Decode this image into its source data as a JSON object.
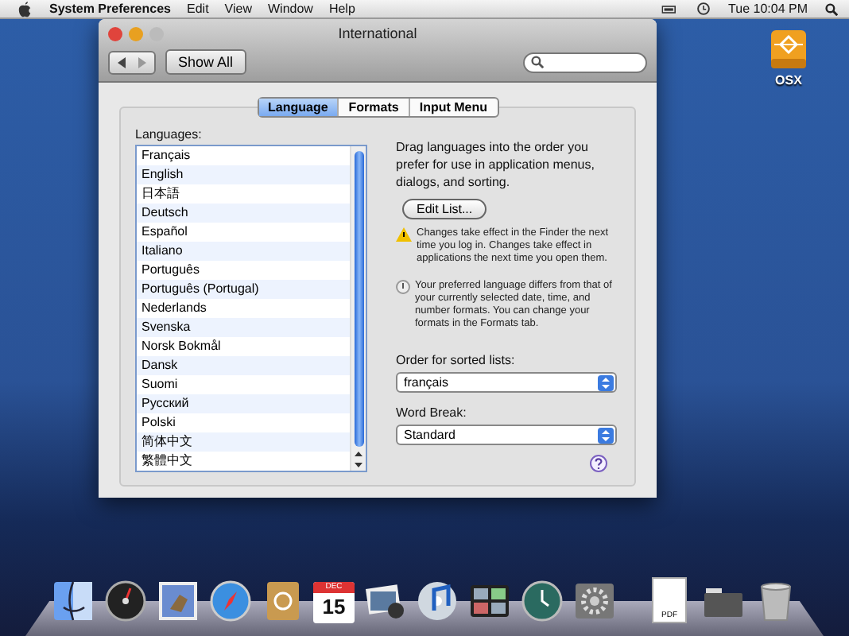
{
  "menu_bar": {
    "app": "System Preferences",
    "items": [
      "Edit",
      "View",
      "Window",
      "Help"
    ],
    "clock": "Tue 10:04 PM"
  },
  "desktop_icons": [
    {
      "label": "OSX"
    }
  ],
  "window": {
    "title": "International",
    "show_all": "Show All",
    "tabs": [
      {
        "label": "Language",
        "selected": true
      },
      {
        "label": "Formats",
        "selected": false
      },
      {
        "label": "Input Menu",
        "selected": false
      }
    ],
    "languages_label": "Languages:",
    "languages": [
      "Français",
      "English",
      "日本語",
      "Deutsch",
      "Español",
      "Italiano",
      "Português",
      "Português (Portugal)",
      "Nederlands",
      "Svenska",
      "Norsk Bokmål",
      "Dansk",
      "Suomi",
      "Русский",
      "Polski",
      "简体中文",
      "繁體中文"
    ],
    "description": "Drag languages into the order you prefer for use in application menus, dialogs, and sorting.",
    "edit_button": "Edit List...",
    "notes": [
      {
        "kind": "warning",
        "text": "Changes take effect in the Finder the next time you log in. Changes take effect in applications the next time you open them."
      },
      {
        "kind": "info",
        "text": "Your preferred language differs from that of your currently selected date, time, and number formats. You can change your formats in the Formats tab."
      }
    ],
    "sorted_label": "Order for sorted lists:",
    "sorted_value": "français",
    "word_break_label": "Word Break:",
    "word_break_value": "Standard"
  },
  "dock": [
    {
      "kind": "finder"
    },
    {
      "kind": "dashboard"
    },
    {
      "kind": "mail"
    },
    {
      "kind": "safari"
    },
    {
      "kind": "addressbook"
    },
    {
      "kind": "calendar",
      "month": "DEC",
      "day": "15"
    },
    {
      "kind": "photos"
    },
    {
      "kind": "music"
    },
    {
      "kind": "spaces"
    },
    {
      "kind": "timemachine"
    },
    {
      "kind": "settings"
    },
    {
      "kind": "separator"
    },
    {
      "kind": "document",
      "label": "PDF"
    },
    {
      "kind": "folder"
    },
    {
      "kind": "trash"
    }
  ]
}
